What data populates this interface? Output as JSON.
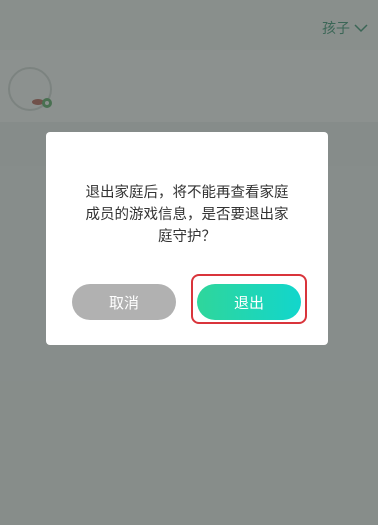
{
  "header": {
    "child_selector_label": "孩子"
  },
  "dialog": {
    "message_line1": "退出家庭后，将不能再查看家庭",
    "message_line2": "成员的游戏信息，是否要退出家",
    "message_line3": "庭守护？",
    "cancel_label": "取消",
    "exit_label": "退出"
  },
  "colors": {
    "accent_green": "#2a8f6a",
    "exit_gradient_start": "#2fd69b",
    "exit_gradient_end": "#12d6cc",
    "cancel_gray": "#b1b1b1",
    "highlight_red": "#d9343b"
  },
  "icons": {
    "selector_chevron": "chevron-down-icon",
    "avatar": "avatar-icon"
  }
}
